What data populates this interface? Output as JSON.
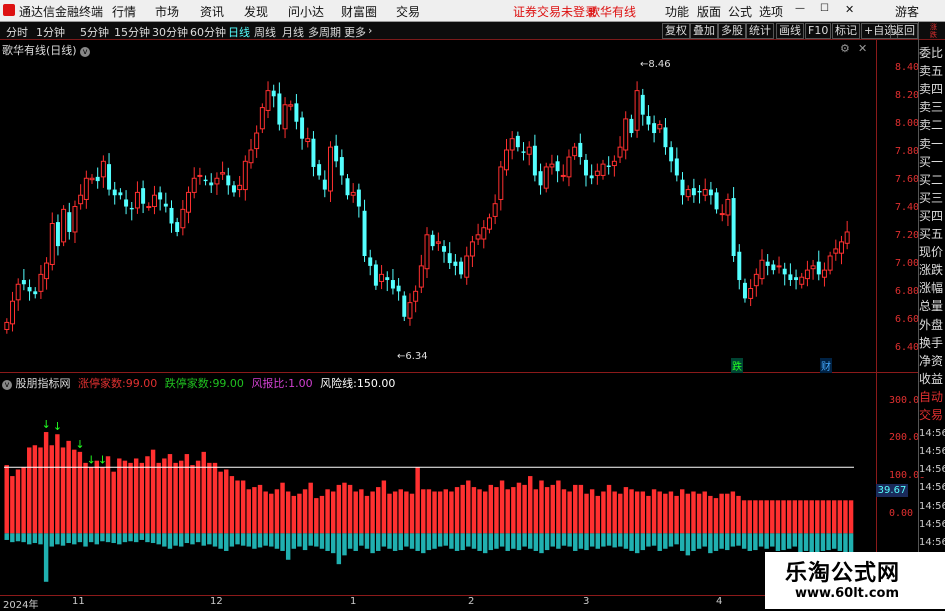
{
  "app": {
    "title": "通达信金融终端",
    "menu": [
      "行情",
      "市场",
      "资讯",
      "发现",
      "问小达",
      "财富圈",
      "交易"
    ],
    "login_status": "证券交易未登录",
    "formula_name": "歌华有线",
    "right_menu": [
      "功能",
      "版面",
      "公式",
      "选项",
      "游客"
    ]
  },
  "periods": {
    "items": [
      "分时",
      "1分钟",
      "5分钟",
      "15分钟",
      "30分钟",
      "60分钟",
      "日线",
      "周线",
      "月线",
      "多周期",
      "更多"
    ],
    "active": "日线"
  },
  "toolbar_right": [
    "复权",
    "叠加",
    "多股",
    "统计",
    "画线",
    "F10",
    "标记",
    "+自选",
    "返回"
  ],
  "main_chart": {
    "title": "歌华有线(日线)",
    "high_label": "8.46",
    "low_label": "6.34",
    "yticks": [
      "8.40",
      "8.20",
      "8.00",
      "7.80",
      "7.60",
      "7.40",
      "7.20",
      "7.00",
      "6.80",
      "6.60",
      "6.40"
    ],
    "marker_die": "跌",
    "marker_cai": "财"
  },
  "indicator": {
    "name": "股朋指标网",
    "items": [
      {
        "label": "涨停家数:",
        "value": "99.00",
        "color": "#e03030"
      },
      {
        "label": "跌停家数:",
        "value": "99.00",
        "color": "#20c020"
      },
      {
        "label": "风报比:",
        "value": "1.00",
        "color": "#d040d0"
      },
      {
        "label": "风险线:",
        "value": "150.00",
        "color": "#ffffff"
      }
    ],
    "yticks": [
      "300.00",
      "200.00",
      "100.00",
      "0.00"
    ],
    "current_value": "39.67"
  },
  "time_axis": [
    "2024年",
    "11",
    "12",
    "1",
    "2",
    "3",
    "4"
  ],
  "right_panel": {
    "top_label": "涨\n跌\n5\n100",
    "items": [
      "委比",
      "卖五",
      "卖四",
      "卖三",
      "卖二",
      "卖一",
      "买一",
      "买二",
      "买三",
      "买四",
      "买五",
      "现价",
      "涨跌",
      "涨幅",
      "总量",
      "外盘",
      "换手",
      "净资",
      "收益",
      "自动",
      "交易",
      "14:56",
      "14:56",
      "14:56",
      "14:56",
      "14:56",
      "14:56",
      "14:56",
      "14:56"
    ]
  },
  "watermark": {
    "title": "乐淘公式网",
    "url": "www.60lt.com"
  },
  "colors": {
    "up": "#ff3030",
    "down": "#54ffff",
    "grid": "#8b1a1a",
    "bg": "#000000"
  },
  "chart_data": {
    "type": "candlestick",
    "y_range": [
      6.3,
      8.55
    ],
    "close": [
      6.58,
      6.73,
      6.85,
      6.85,
      6.8,
      6.78,
      6.92,
      7.0,
      7.28,
      7.12,
      7.38,
      7.22,
      7.4,
      7.48,
      7.6,
      7.6,
      7.58,
      7.72,
      7.52,
      7.48,
      7.48,
      7.4,
      7.38,
      7.5,
      7.42,
      7.4,
      7.48,
      7.45,
      7.4,
      7.28,
      7.22,
      7.38,
      7.5,
      7.6,
      7.62,
      7.58,
      7.55,
      7.6,
      7.64,
      7.55,
      7.5,
      7.55,
      7.72,
      7.8,
      7.92,
      8.1,
      8.22,
      8.18,
      7.98,
      8.12,
      8.12,
      8.0,
      7.88,
      7.88,
      7.68,
      7.62,
      7.52,
      7.82,
      7.72,
      7.62,
      7.48,
      7.5,
      7.4,
      7.05,
      6.98,
      6.84,
      6.92,
      6.88,
      6.82,
      6.8,
      6.62,
      6.72,
      6.8,
      6.98,
      7.2,
      7.12,
      7.15,
      7.08,
      7.0,
      6.98,
      6.92,
      7.05,
      7.15,
      7.2,
      7.25,
      7.32,
      7.42,
      7.68,
      7.8,
      7.88,
      7.82,
      7.78,
      7.82,
      7.62,
      7.55,
      7.68,
      7.7,
      7.65,
      7.62,
      7.75,
      7.82,
      7.75,
      7.62,
      7.6,
      7.65,
      7.7,
      7.68,
      7.72,
      7.82,
      8.02,
      7.92,
      8.22,
      8.05,
      7.98,
      7.92,
      7.98,
      7.82,
      7.72,
      7.62,
      7.48,
      7.52,
      7.48,
      7.5,
      7.52,
      7.48,
      7.38,
      7.35,
      7.45,
      7.05,
      6.88,
      6.75,
      6.82,
      6.92,
      7.02,
      6.98,
      6.95,
      6.98,
      6.92,
      6.88,
      6.88,
      6.9,
      6.95,
      6.98,
      6.92,
      6.95,
      7.05,
      7.1,
      7.15,
      7.22
    ],
    "indicator_up": [
      155,
      130,
      145,
      150,
      195,
      200,
      195,
      230,
      200,
      225,
      195,
      210,
      190,
      185,
      160,
      150,
      165,
      150,
      175,
      140,
      170,
      165,
      160,
      170,
      160,
      175,
      190,
      160,
      170,
      180,
      160,
      165,
      180,
      155,
      165,
      185,
      160,
      160,
      140,
      145,
      130,
      120,
      120,
      100,
      105,
      110,
      95,
      90,
      100,
      115,
      95,
      85,
      90,
      100,
      115,
      80,
      85,
      100,
      95,
      110,
      115,
      110,
      95,
      100,
      85,
      95,
      105,
      120,
      90,
      95,
      100,
      95,
      90,
      150,
      100,
      100,
      95,
      95,
      100,
      95,
      105,
      110,
      120,
      105,
      100,
      95,
      110,
      105,
      120,
      100,
      105,
      115,
      110,
      130,
      100,
      120,
      105,
      110,
      120,
      100,
      95,
      110,
      110,
      90,
      100,
      85,
      95,
      110,
      95,
      90,
      105,
      100,
      95,
      95,
      85,
      100,
      95,
      90,
      95,
      85,
      100,
      90,
      95,
      90,
      95,
      85,
      80,
      90,
      90,
      95,
      85,
      75,
      75,
      75,
      75,
      75,
      75,
      75,
      75,
      75,
      75,
      75,
      75,
      75,
      75,
      75,
      75,
      75,
      75,
      75,
      75
    ],
    "indicator_down": [
      -15,
      -20,
      -18,
      -20,
      -25,
      -22,
      -25,
      -110,
      -30,
      -25,
      -28,
      -22,
      -25,
      -20,
      -30,
      -20,
      -25,
      -18,
      -20,
      -22,
      -25,
      -20,
      -18,
      -20,
      -15,
      -20,
      -22,
      -25,
      -30,
      -35,
      -28,
      -30,
      -22,
      -25,
      -20,
      -28,
      -25,
      -30,
      -35,
      -40,
      -30,
      -25,
      -28,
      -30,
      -35,
      -32,
      -28,
      -30,
      -35,
      -40,
      -60,
      -35,
      -30,
      -38,
      -28,
      -30,
      -35,
      -40,
      -45,
      -70,
      -50,
      -35,
      -40,
      -28,
      -35,
      -45,
      -40,
      -30,
      -35,
      -40,
      -38,
      -30,
      -35,
      -40,
      -45,
      -38,
      -35,
      -30,
      -28,
      -35,
      -40,
      -38,
      -30,
      -35,
      -40,
      -45,
      -38,
      -35,
      -30,
      -40,
      -35,
      -38,
      -30,
      -35,
      -40,
      -45,
      -38,
      -30,
      -35,
      -28,
      -30,
      -40,
      -35,
      -38,
      -30,
      -35,
      -30,
      -28,
      -32,
      -30,
      -35,
      -40,
      -45,
      -38,
      -30,
      -28,
      -40,
      -35,
      -30,
      -25,
      -40,
      -50,
      -40,
      -35,
      -30,
      -45,
      -40,
      -35,
      -38,
      -30,
      -28,
      -35,
      -40,
      -38,
      -30,
      -35,
      -30,
      -40,
      -38,
      -35,
      -30,
      -45,
      -40,
      -50,
      -45,
      -40,
      -38,
      -35,
      -40,
      -60,
      -80
    ],
    "indicator_range": [
      -140,
      330
    ],
    "risk_line": 150,
    "arrow_positions": [
      7,
      9,
      13,
      15,
      17
    ]
  }
}
